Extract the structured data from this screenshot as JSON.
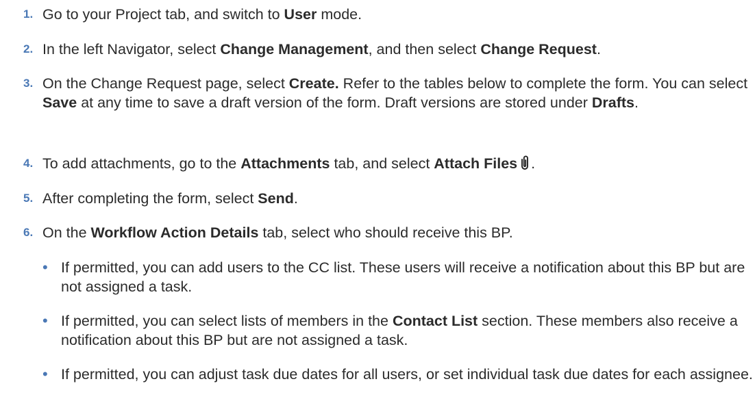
{
  "steps": [
    {
      "num": "1.",
      "parts": [
        "Go to your Project tab, and switch to ",
        "User",
        " mode."
      ]
    },
    {
      "num": "2.",
      "parts": [
        "In the left Navigator, select ",
        "Change Management",
        ", and then select ",
        "Change Request",
        "."
      ]
    },
    {
      "num": "3.",
      "parts": [
        "On the Change Request page, select ",
        "Create.",
        " Refer to the tables below to complete the form. You can select ",
        "Save",
        " at any time to save a draft version of the form. Draft versions are stored under ",
        "Drafts",
        "."
      ]
    },
    {
      "num": "4.",
      "parts": [
        "To add attachments, go to the ",
        "Attachments",
        " tab, and select ",
        "Attach Files",
        "."
      ],
      "icon": "paperclip-icon"
    },
    {
      "num": "5.",
      "parts": [
        "After completing the form, select ",
        "Send",
        "."
      ]
    },
    {
      "num": "6.",
      "parts": [
        "On the ",
        "Workflow Action Details",
        " tab, select who should receive this BP."
      ]
    }
  ],
  "bullets": [
    {
      "marker": "•",
      "parts": [
        "If permitted, you can add users to the CC list. These users will receive a notification about this BP but are not assigned a task."
      ]
    },
    {
      "marker": "•",
      "parts": [
        "If permitted, you can select lists of members in the ",
        "Contact List",
        " section. These members also receive a notification about this BP but are not assigned a task."
      ]
    },
    {
      "marker": "•",
      "parts": [
        "If permitted, you can adjust task due dates for all users, or set individual task due dates for each assignee."
      ]
    }
  ],
  "colors": {
    "number": "#4a78b5",
    "text": "#2b2b2b"
  }
}
